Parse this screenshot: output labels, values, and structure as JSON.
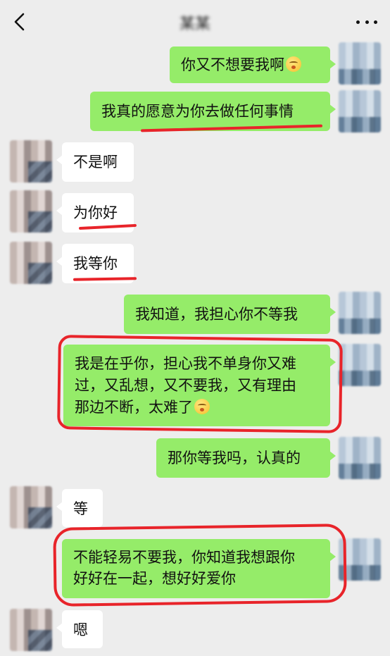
{
  "header": {
    "title": "某某",
    "back_icon": "chevron-left-icon",
    "more_icon": "more-dots-icon"
  },
  "messages": [
    {
      "side": "me",
      "text": "你又不想要我啊",
      "emoji": "slight-frown-emoji"
    },
    {
      "side": "me",
      "text": "我真的愿意为你去做任何事情"
    },
    {
      "side": "her",
      "text": "不是啊"
    },
    {
      "side": "her",
      "text": "为你好"
    },
    {
      "side": "her",
      "text": "我等你"
    },
    {
      "side": "me",
      "text": "我知道，我担心你不等我"
    },
    {
      "side": "me",
      "lines": [
        "我是在乎你，担心我不单身你又难",
        "过，又乱想，又不要我，又有理由",
        "那边不断，太难了"
      ],
      "emoji": "awkward-smile-emoji"
    },
    {
      "side": "me",
      "text": "那你等我吗，认真的"
    },
    {
      "side": "her",
      "text": "等"
    },
    {
      "side": "me",
      "lines": [
        "不能轻易不要我，你知道我想跟你",
        "好好在一起，想好好爱你"
      ]
    },
    {
      "side": "her",
      "text": "嗯"
    }
  ],
  "colors": {
    "background": "#ededed",
    "my_bubble": "#95ec69",
    "her_bubble": "#ffffff",
    "annotation_red": "#e8242a"
  }
}
